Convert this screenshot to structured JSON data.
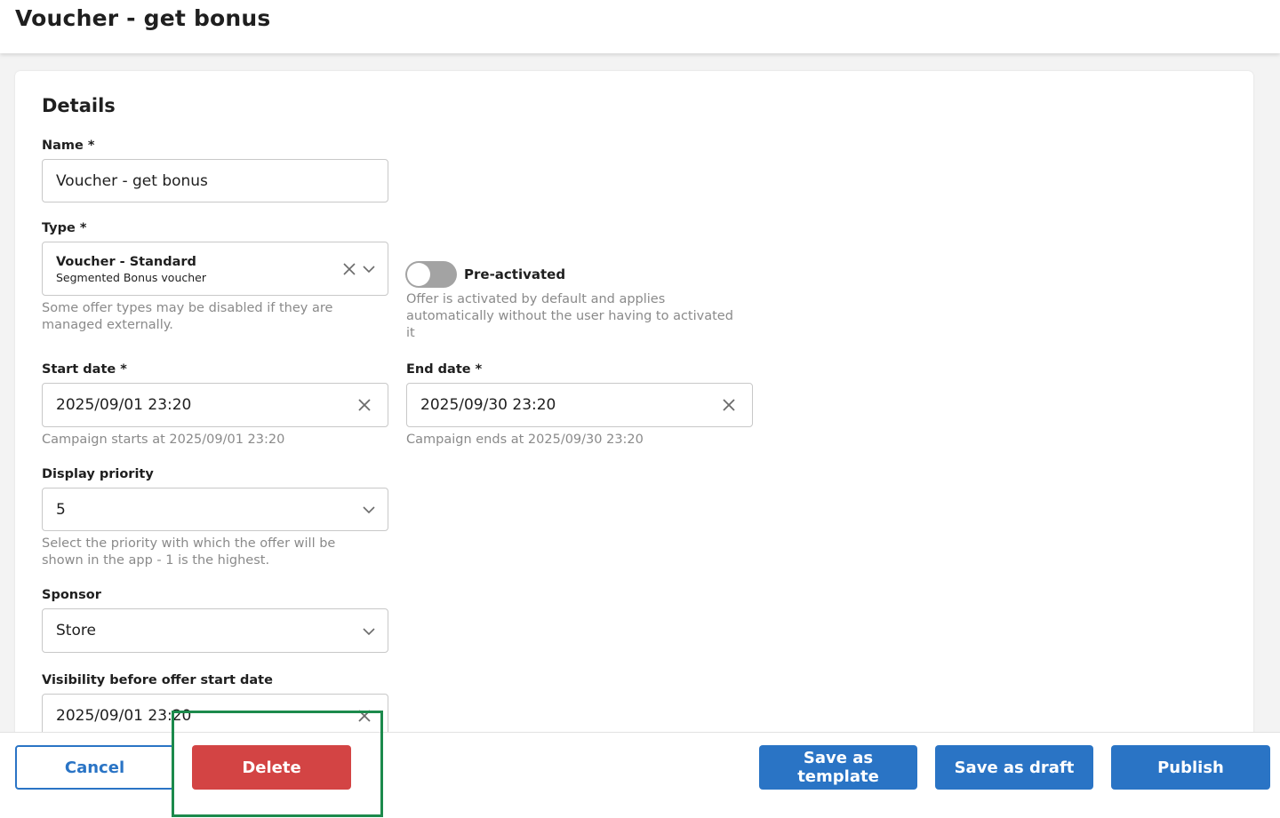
{
  "header": {
    "title": "Voucher - get bonus"
  },
  "details": {
    "section_title": "Details",
    "name": {
      "label": "Name *",
      "value": "Voucher - get bonus"
    },
    "type": {
      "label": "Type *",
      "value_title": "Voucher - Standard",
      "value_subtitle": "Segmented Bonus voucher",
      "helper_line1": "Some offer types may be disabled if they are",
      "helper_line2": "managed externally."
    },
    "pre_activated": {
      "label": "Pre-activated",
      "checked": false,
      "helper_line1": "Offer is activated by default and applies",
      "helper_line2": "automatically without the user having to activated",
      "helper_line3": "it"
    },
    "start_date": {
      "label": "Start date *",
      "value": "2025/09/01 23:20",
      "helper": "Campaign starts at 2025/09/01 23:20"
    },
    "end_date": {
      "label": "End date *",
      "value": "2025/09/30 23:20",
      "helper": "Campaign ends at 2025/09/30 23:20"
    },
    "display_priority": {
      "label": "Display priority",
      "value": "5",
      "helper_line1": "Select the priority with which the offer will be",
      "helper_line2": "shown in the app - 1 is the highest."
    },
    "sponsor": {
      "label": "Sponsor",
      "value": "Store"
    },
    "visibility": {
      "label": "Visibility before offer start date",
      "value": "2025/09/01 23:20"
    }
  },
  "footer": {
    "cancel_label": "Cancel",
    "delete_label": "Delete",
    "save_template_label": "Save as template",
    "save_draft_label": "Save as draft",
    "publish_label": "Publish"
  },
  "icons": {
    "clear": "close-icon",
    "dropdown": "chevron-down-icon"
  },
  "colors": {
    "primary": "#2a74c5",
    "danger": "#d34444",
    "highlight": "#1c8a4c",
    "toggle_off": "#a3a3a3"
  }
}
